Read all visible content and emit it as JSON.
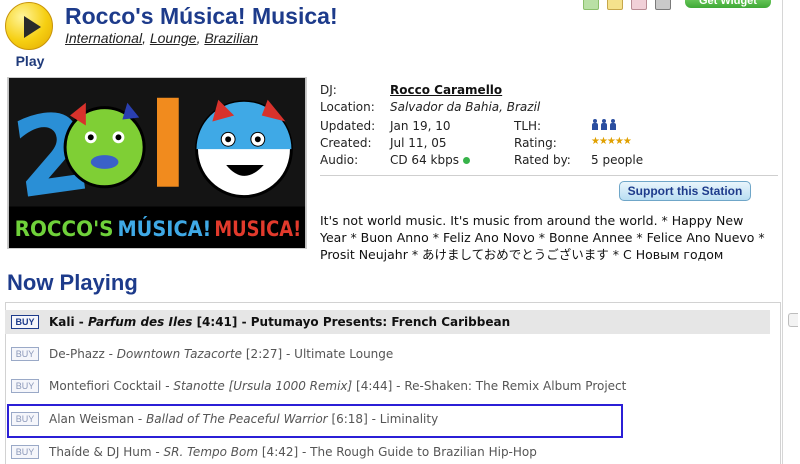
{
  "toolbar": {
    "icons": [
      "plus-icon",
      "mail-icon",
      "calendar-icon",
      "cube-icon"
    ],
    "widget_label": "Get Widget"
  },
  "player": {
    "play_label": "Play"
  },
  "station": {
    "title": "Rocco's Música! Musica!",
    "genres": [
      "International",
      "Lounge",
      "Brazilian"
    ],
    "artwork_text": [
      "2",
      "0",
      "1",
      "0"
    ],
    "artwork_caption": [
      "ROCCO'S",
      "MÚSICA!",
      "MUSICA!"
    ]
  },
  "info": {
    "dj_label": "DJ:",
    "dj_value": "Rocco Caramello",
    "location_label": "Location:",
    "location_value": "Salvador da Bahia, Brazil",
    "updated_label": "Updated:",
    "updated_value": "Jan 19, 10",
    "created_label": "Created:",
    "created_value": "Jul 11, 05",
    "audio_label": "Audio:",
    "audio_value": "CD 64 kbps",
    "tlh_label": "TLH:",
    "rating_label": "Rating:",
    "rating_stars": 4.5,
    "ratedby_label": "Rated by:",
    "ratedby_value": "5 people"
  },
  "support_label": "Support this Station",
  "description": "It's not world music. It's music from around the world. * Happy New Year * Buon Anno * Feliz Ano Novo * Bonne Annee * Felice Ano Nuevo * Prosit Neujahr * あけましておめでとうございます * С Новым годом",
  "now_playing": {
    "heading": "Now Playing",
    "buy_label": "BUY",
    "tracks": [
      {
        "artist": "Kali",
        "title": "Parfum des Iles",
        "duration": "[4:41]",
        "album": "Putumayo Presents: French Caribbean"
      },
      {
        "artist": "De-Phazz",
        "title": "Downtown Tazacorte",
        "duration": "[2:27]",
        "album": "Ultimate Lounge"
      },
      {
        "artist": "Montefiori Cocktail",
        "title": "Stanotte [Ursula 1000 Remix]",
        "duration": "[4:44]",
        "album": "Re-Shaken: The Remix Album Project"
      },
      {
        "artist": "Alan Weisman",
        "title": "Ballad of The Peaceful Warrior",
        "duration": "[6:18]",
        "album": "Liminality"
      },
      {
        "artist": "Thaíde & DJ Hum",
        "title": "SR. Tempo Bom",
        "duration": "[4:42]",
        "album": "The Rough Guide to Brazilian Hip-Hop"
      }
    ]
  }
}
